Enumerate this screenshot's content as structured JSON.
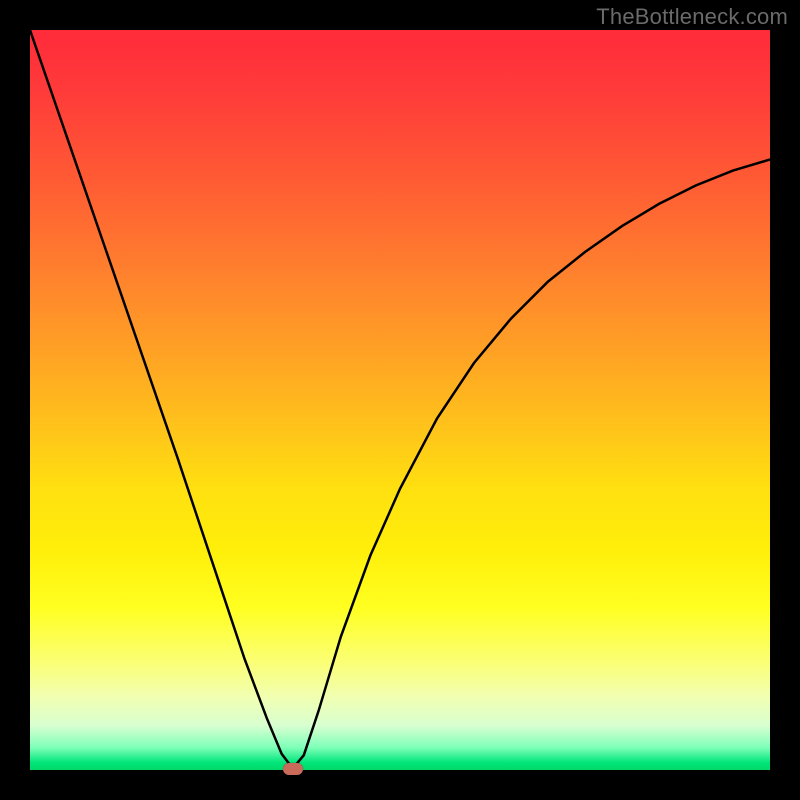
{
  "watermark": {
    "text": "TheBottleneck.com"
  },
  "chart_data": {
    "type": "line",
    "title": "",
    "xlabel": "",
    "ylabel": "",
    "xlim": [
      0,
      100
    ],
    "ylim": [
      0,
      100
    ],
    "x": [
      0,
      5,
      10,
      15,
      20,
      25,
      29,
      32,
      34,
      35.5,
      37,
      39,
      42,
      46,
      50,
      55,
      60,
      65,
      70,
      75,
      80,
      85,
      90,
      95,
      100
    ],
    "values": [
      100,
      85.5,
      71,
      56.5,
      42,
      27,
      15,
      7,
      2.2,
      0.2,
      2,
      8,
      18,
      29,
      38,
      47.5,
      55,
      61,
      66,
      70,
      73.5,
      76.5,
      79,
      81,
      82.5
    ],
    "note_bands": [
      {
        "color": "green",
        "y_range": [
          0,
          3
        ]
      },
      {
        "color": "yellow",
        "y_range": [
          3,
          60
        ]
      },
      {
        "color": "red",
        "y_range": [
          60,
          100
        ]
      }
    ],
    "marker": {
      "shape": "rounded-rect",
      "color": "#c96a5a",
      "x": 35.5,
      "y": 0.2
    }
  }
}
